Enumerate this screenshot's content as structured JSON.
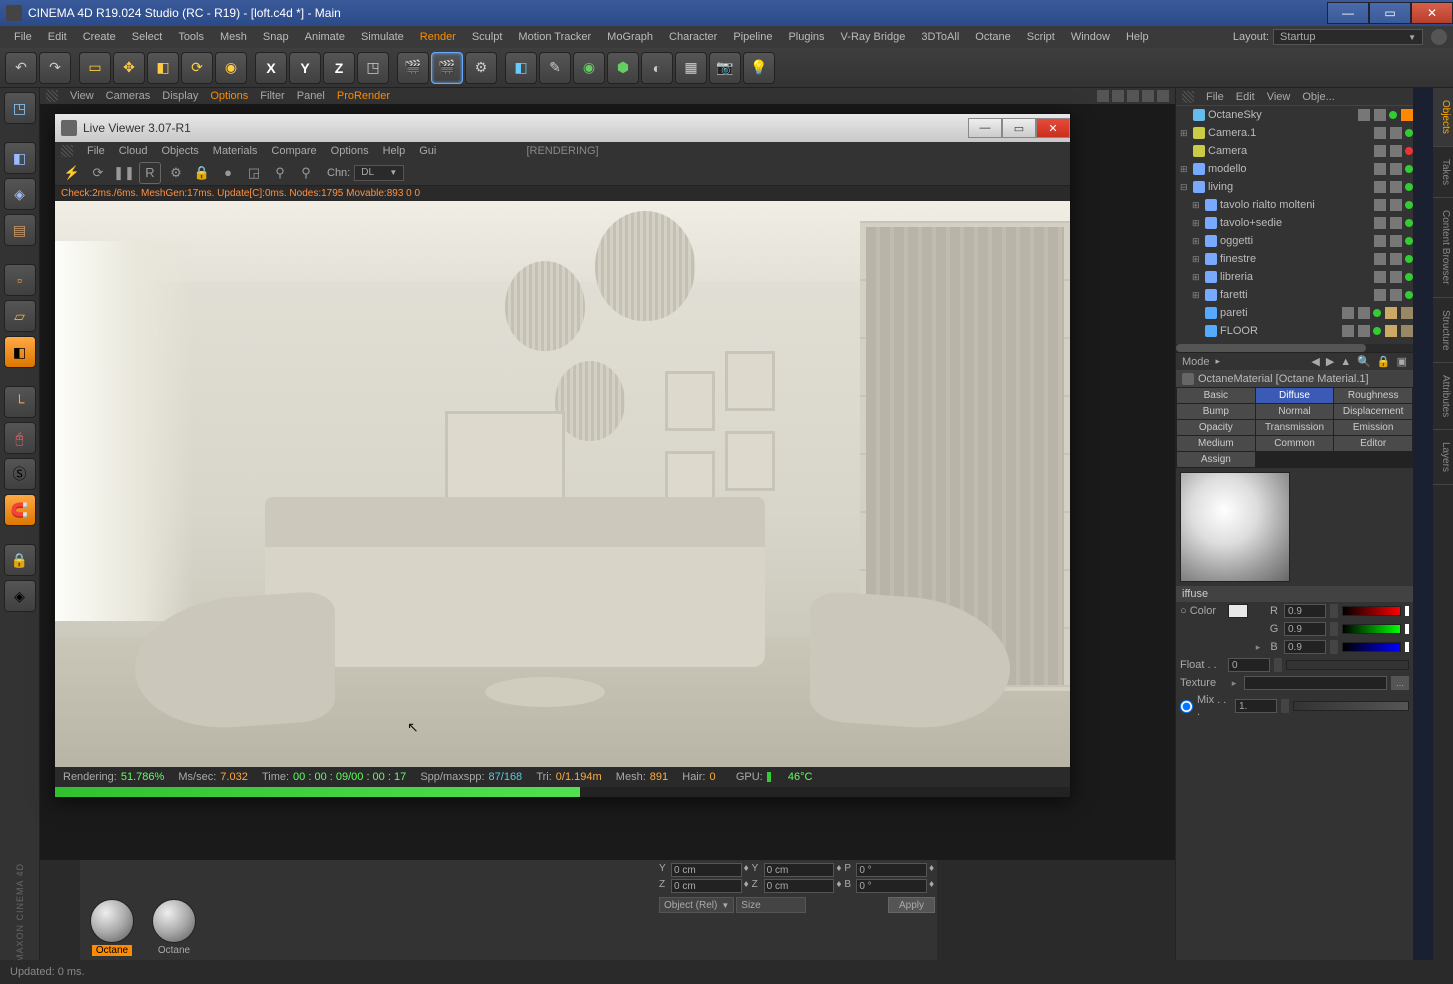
{
  "title": "CINEMA 4D R19.024 Studio (RC - R19) - [loft.c4d *] - Main",
  "main_menu": [
    "File",
    "Edit",
    "Create",
    "Select",
    "Tools",
    "Mesh",
    "Snap",
    "Animate",
    "Simulate",
    "Render",
    "Sculpt",
    "Motion Tracker",
    "MoGraph",
    "Character",
    "Pipeline",
    "Plugins",
    "V-Ray Bridge",
    "3DToAll",
    "Octane",
    "Script",
    "Window",
    "Help"
  ],
  "main_menu_hot": "Render",
  "layout": {
    "label": "Layout:",
    "value": "Startup"
  },
  "viewport_menu": [
    "View",
    "Cameras",
    "Display",
    "Options",
    "Filter",
    "Panel",
    "ProRender"
  ],
  "viewport_menu_hot": [
    "Options",
    "ProRender"
  ],
  "objects_panel": {
    "menu": [
      "File",
      "Edit",
      "View",
      "Obje..."
    ],
    "items": [
      {
        "name": "OctaneSky",
        "icon": "#66bbee",
        "expand": "",
        "orange": true
      },
      {
        "name": "Camera.1",
        "icon": "#cccc44",
        "expand": "⊞"
      },
      {
        "name": "Camera",
        "icon": "#cccc44",
        "expand": "",
        "red": true
      },
      {
        "name": "modello",
        "icon": "#77aaff",
        "expand": "⊞",
        "null": true
      },
      {
        "name": "living",
        "icon": "#77aaff",
        "expand": "⊟",
        "null": true
      },
      {
        "name": "tavolo rialto molteni",
        "icon": "#77aaff",
        "expand": "⊞",
        "null": true,
        "indent": 1
      },
      {
        "name": "tavolo+sedie",
        "icon": "#77aaff",
        "expand": "⊞",
        "null": true,
        "indent": 1
      },
      {
        "name": "oggetti",
        "icon": "#77aaff",
        "expand": "⊞",
        "null": true,
        "indent": 1
      },
      {
        "name": "finestre",
        "icon": "#77aaff",
        "expand": "⊞",
        "null": true,
        "indent": 1
      },
      {
        "name": "libreria",
        "icon": "#77aaff",
        "expand": "⊞",
        "null": true,
        "indent": 1
      },
      {
        "name": "faretti",
        "icon": "#77aaff",
        "expand": "⊞",
        "null": true,
        "indent": 1
      },
      {
        "name": "pareti",
        "icon": "#55aaff",
        "expand": "",
        "indent": 1,
        "poly": true,
        "mat": true
      },
      {
        "name": "FLOOR",
        "icon": "#55aaff",
        "expand": "",
        "indent": 1,
        "poly": true,
        "mat": true
      }
    ]
  },
  "attributes": {
    "mode_label": "Mode",
    "title": "OctaneMaterial [Octane Material.1]",
    "tabs": [
      "Basic",
      "Diffuse",
      "Roughness",
      "Bump",
      "Normal",
      "Displacement",
      "Opacity",
      "Transmission",
      "Emission",
      "Medium",
      "Common",
      "Editor",
      "Assign"
    ],
    "active_tab": "Diffuse",
    "section": "iffuse",
    "color_label": "Color",
    "channels": [
      {
        "ch": "R",
        "val": "0.9",
        "grad": "linear-gradient(to right,#000,#f00)"
      },
      {
        "ch": "G",
        "val": "0.9",
        "grad": "linear-gradient(to right,#000,#0f0)"
      },
      {
        "ch": "B",
        "val": "0.9",
        "grad": "linear-gradient(to right,#000,#00f)"
      }
    ],
    "float_label": "Float . .",
    "float_val": "0",
    "texture_label": "Texture",
    "texture_btn": "...",
    "mix_label": "Mix . . .",
    "mix_val": "1."
  },
  "coord": {
    "rows": [
      {
        "a": "Y",
        "av": "0 cm",
        "b": "Y",
        "bv": "0 cm",
        "c": "P",
        "cv": "0 °"
      },
      {
        "a": "Z",
        "av": "0 cm",
        "b": "Z",
        "bv": "0 cm",
        "c": "B",
        "cv": "0 °"
      }
    ],
    "mode": "Object (Rel)",
    "size": "Size",
    "apply": "Apply"
  },
  "materials": [
    {
      "label": "Octane",
      "sel": true
    },
    {
      "label": "Octane",
      "sel": false
    }
  ],
  "status": "Updated: 0 ms.",
  "right_tabs": [
    "Objects",
    "Takes",
    "Content Browser",
    "Structure",
    "Attributes",
    "Layers"
  ],
  "live_viewer": {
    "title": "Live Viewer 3.07-R1",
    "menu": [
      "File",
      "Cloud",
      "Objects",
      "Materials",
      "Compare",
      "Options",
      "Help",
      "Gui"
    ],
    "render_state": "[RENDERING]",
    "chn_label": "Chn:",
    "chn_value": "DL",
    "check_line": "Check:2ms./6ms. MeshGen:17ms. Update[C]:0ms. Nodes:1795 Movable:893  0 0",
    "status": {
      "rendering_l": "Rendering:",
      "rendering_v": "51.786%",
      "mssec_l": "Ms/sec:",
      "mssec_v": "7.032",
      "time_l": "Time:",
      "time_v": "00 : 00 : 09/00 : 00 : 17",
      "spp_l": "Spp/maxspp:",
      "spp_v": "87/168",
      "tri_l": "Tri:",
      "tri_v": "0/1.194m",
      "mesh_l": "Mesh:",
      "mesh_v": "891",
      "hair_l": "Hair:",
      "hair_v": "0",
      "gpu_l": "GPU:",
      "temp": "46°C"
    }
  }
}
